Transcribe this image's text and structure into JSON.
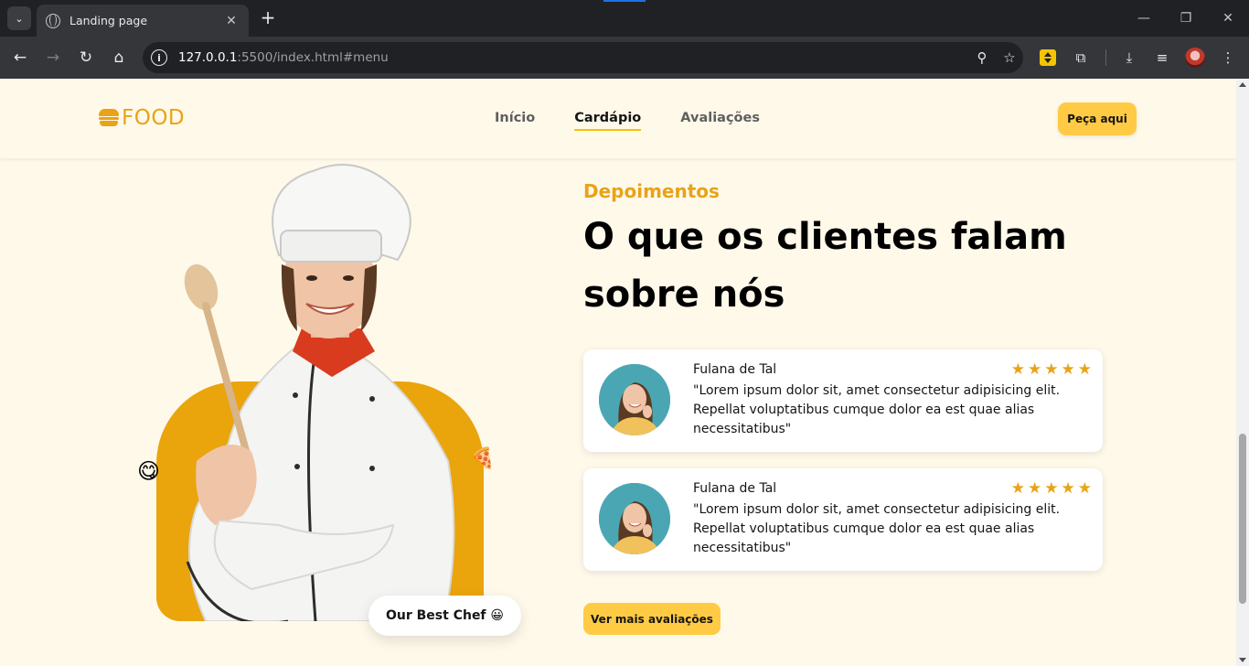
{
  "browser": {
    "tab_title": "Landing page",
    "tab_close": "✕",
    "new_tab": "+",
    "url_host": "127.0.0.1",
    "url_path": ":5500/index.html#menu",
    "window_minimize": "—",
    "window_restore": "❐",
    "window_close": "✕"
  },
  "header": {
    "logo_text": "FOOD",
    "nav": [
      {
        "label": "Início",
        "active": false
      },
      {
        "label": "Cardápio",
        "active": true
      },
      {
        "label": "Avaliações",
        "active": false
      }
    ],
    "order_button": "Peça aqui"
  },
  "hero": {
    "badge": "Our Best Chef 😀",
    "emoji_left": "😋",
    "emoji_right": "🍕"
  },
  "testimonials": {
    "kicker": "Depoimentos",
    "title": "O que os clientes falam sobre nós",
    "reviews": [
      {
        "name": "Fulana de Tal",
        "rating": 5,
        "text": "\"Lorem ipsum dolor sit, amet consectetur adipisicing elit. Repellat voluptatibus cumque dolor ea est quae alias necessitatibus\""
      },
      {
        "name": "Fulana de Tal",
        "rating": 5,
        "text": "\"Lorem ipsum dolor sit, amet consectetur adipisicing elit. Repellat voluptatibus cumque dolor ea est quae alias necessitatibus\""
      }
    ],
    "more_button": "Ver mais avaliações"
  },
  "colors": {
    "accent": "#e8a317",
    "button": "#ffcb45",
    "page_bg": "#fff9ea"
  }
}
